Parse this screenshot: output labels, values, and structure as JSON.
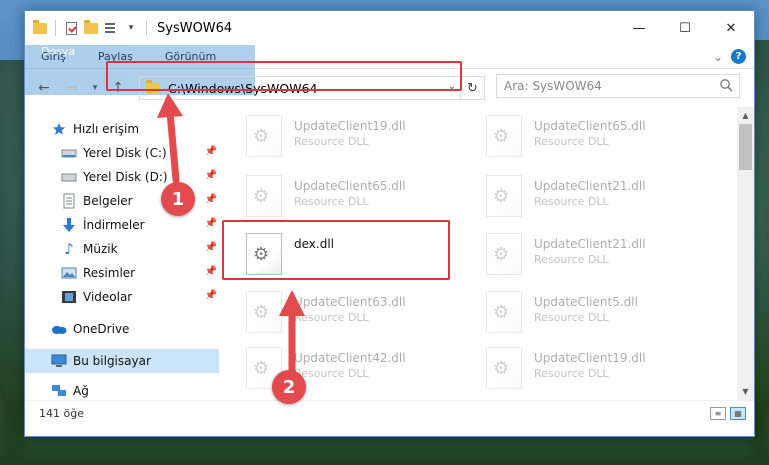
{
  "window": {
    "title": "SysWOW64",
    "controls": {
      "minimize": "—",
      "maximize": "☐",
      "close": "✕"
    }
  },
  "ribbon": {
    "tabs": [
      "Dosya",
      "Giriş",
      "Paylaş",
      "Görünüm"
    ],
    "collapse_symbol": "⌄",
    "help_symbol": "?"
  },
  "nav": {
    "address": "C:\\Windows\\SysWOW64",
    "search_placeholder": "Ara: SysWOW64"
  },
  "sidebar": {
    "quick_access": "Hızlı erişim",
    "items": [
      {
        "label": "Yerel Disk (C:)",
        "icon": "drive-icon"
      },
      {
        "label": "Yerel Disk (D:)",
        "icon": "drive-icon"
      },
      {
        "label": "Belgeler",
        "icon": "documents-icon"
      },
      {
        "label": "İndirmeler",
        "icon": "downloads-icon"
      },
      {
        "label": "Müzik",
        "icon": "music-icon"
      },
      {
        "label": "Resimler",
        "icon": "pictures-icon"
      },
      {
        "label": "Videolar",
        "icon": "videos-icon"
      }
    ],
    "onedrive": "OneDrive",
    "this_pc": "Bu bilgisayar",
    "network": "Ağ"
  },
  "files": [
    {
      "name": "UpdateClient19.dll",
      "type": "Resource DLL"
    },
    {
      "name": "UpdateClient65.dll",
      "type": "Resource DLL"
    },
    {
      "name": "UpdateClient65.dll",
      "type": "Resource DLL"
    },
    {
      "name": "UpdateClient21.dll",
      "type": "Resource DLL"
    },
    {
      "name": "dex.dll",
      "type": ""
    },
    {
      "name": "UpdateClient21.dll",
      "type": "Resource DLL"
    },
    {
      "name": "UpdateClient63.dll",
      "type": "Resource DLL"
    },
    {
      "name": "UpdateClient5.dll",
      "type": "Resource DLL"
    },
    {
      "name": "UpdateClient42.dll",
      "type": "Resource DLL"
    },
    {
      "name": "UpdateClient19.dll",
      "type": "Resource DLL"
    }
  ],
  "status": {
    "count": "141 öğe"
  },
  "annotations": {
    "step1": "1",
    "step2": "2",
    "color": "#e24a4e"
  }
}
